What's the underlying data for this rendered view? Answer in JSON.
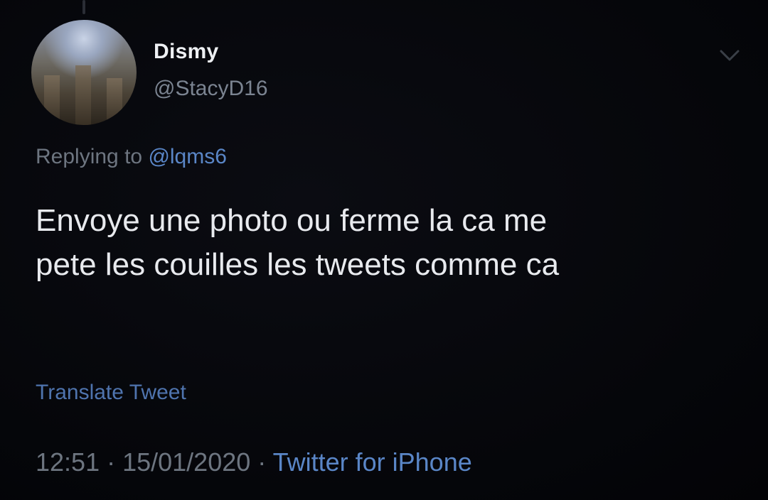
{
  "tweet": {
    "author_name": "Dismy",
    "author_handle": "@StacyD16",
    "reply_prefix": "Replying to",
    "reply_to": "@lqms6",
    "text": "Envoye une photo ou ferme la ca me\npete les couilles les tweets comme ca",
    "translate_label": "Translate Tweet",
    "time": "12:51",
    "separator": " · ",
    "date": "15/01/2020",
    "source": "Twitter for iPhone"
  },
  "icons": {
    "more": "chevron-down-icon",
    "avatar": "avatar"
  },
  "colors": {
    "background": "#05060a",
    "link": "#5a86c7",
    "muted": "#7b8491",
    "text": "#e8eaee"
  }
}
